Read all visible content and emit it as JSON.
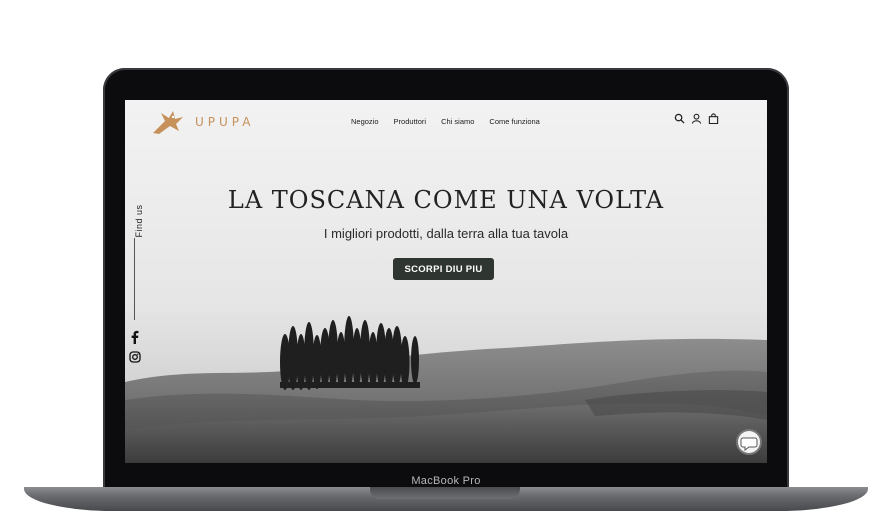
{
  "device": {
    "label": "MacBook Pro"
  },
  "brand": {
    "name": "UPUPA",
    "accent": "#c6915a"
  },
  "nav": {
    "items": [
      "Negozio",
      "Produttori",
      "Chi siamo",
      "Come funziona"
    ]
  },
  "header_icons": [
    "search-icon",
    "user-icon",
    "bag-icon"
  ],
  "social": {
    "title": "Find us",
    "items": [
      "facebook-icon",
      "instagram-icon"
    ]
  },
  "hero": {
    "title": "LA TOSCANA COME UNA VOLTA",
    "subtitle": "I migliori prodotti, dalla terra alla tua tavola",
    "cta": "SCORPI DIU PIU",
    "cta_color": "#2f3530"
  },
  "chat": {
    "icon": "chat-bubble-icon"
  }
}
